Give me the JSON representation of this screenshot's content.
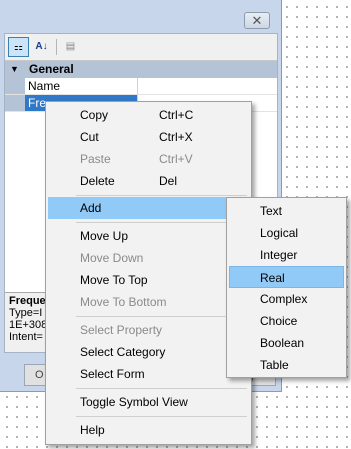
{
  "dialog": {
    "close_label": "✕",
    "toolbar": {
      "categorized_icon": "⚏",
      "alphabetical_label": "A↓",
      "property_pages_icon": "▤"
    },
    "grid": {
      "category": "General",
      "expand_glyph": "▼",
      "rows": [
        {
          "name": "Name"
        },
        {
          "name": "Fre"
        }
      ]
    },
    "description": {
      "title": "Freque",
      "lines": [
        "Type=I",
        "1E+308",
        "Intent="
      ]
    },
    "buttons": [
      "O",
      "p"
    ]
  },
  "context_menu": {
    "items": {
      "copy": {
        "label": "Copy",
        "shortcut": "Ctrl+C"
      },
      "cut": {
        "label": "Cut",
        "shortcut": "Ctrl+X"
      },
      "paste": {
        "label": "Paste",
        "shortcut": "Ctrl+V"
      },
      "delete": {
        "label": "Delete",
        "shortcut": "Del"
      },
      "add": {
        "label": "Add",
        "arrow": "▶"
      },
      "move_up": {
        "label": "Move Up"
      },
      "move_down": {
        "label": "Move Down"
      },
      "move_to_top": {
        "label": "Move To Top"
      },
      "move_to_bottom": {
        "label": "Move To Bottom"
      },
      "select_property": {
        "label": "Select Property"
      },
      "select_category": {
        "label": "Select Category"
      },
      "select_form": {
        "label": "Select Form"
      },
      "toggle_symbol_view": {
        "label": "Toggle Symbol View"
      },
      "help": {
        "label": "Help"
      }
    }
  },
  "add_submenu": {
    "items": [
      "Text",
      "Logical",
      "Integer",
      "Real",
      "Complex",
      "Choice",
      "Boolean",
      "Table"
    ],
    "highlighted": "Real"
  },
  "colors": {
    "menu_highlight": "#91c9f7",
    "dialog_frame": "#c7d6ea",
    "selection": "#3078c8"
  }
}
